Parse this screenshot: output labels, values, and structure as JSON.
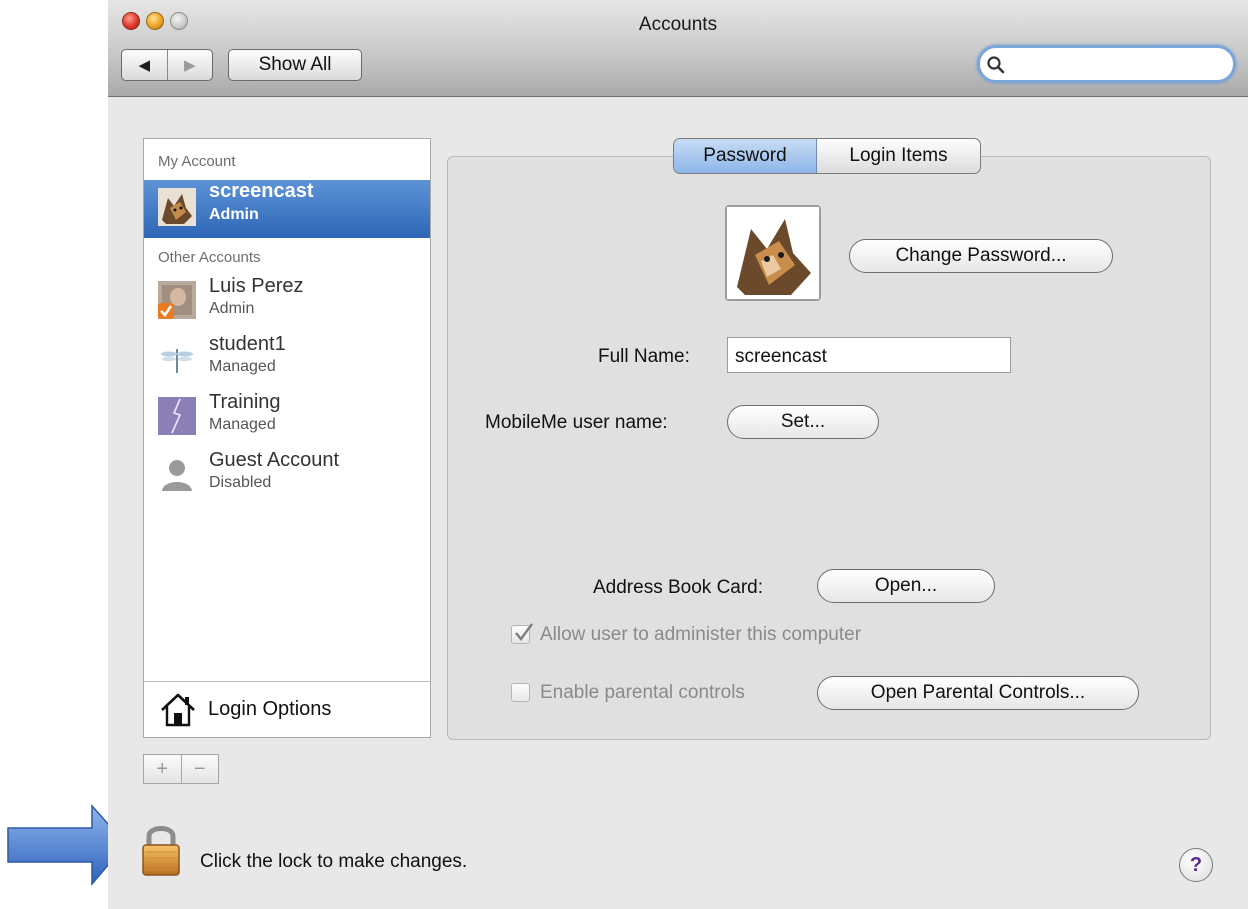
{
  "window": {
    "title": "Accounts"
  },
  "toolbar": {
    "back_glyph": "◀",
    "forward_glyph": "▶",
    "show_all_label": "Show All",
    "search_value": ""
  },
  "sidebar": {
    "my_account_header": "My Account",
    "other_accounts_header": "Other Accounts",
    "accounts": [
      {
        "name": "screencast",
        "role": "Admin",
        "icon": "cat-avatar",
        "selected": true
      },
      {
        "name": "Luis Perez",
        "role": "Admin",
        "icon": "photo-avatar-with-check-badge"
      },
      {
        "name": "student1",
        "role": "Managed",
        "icon": "dragonfly-avatar"
      },
      {
        "name": "Training",
        "role": "Managed",
        "icon": "lightning-avatar"
      },
      {
        "name": "Guest Account",
        "role": "Disabled",
        "icon": "silhouette-avatar"
      }
    ],
    "login_options_label": "Login Options",
    "add_label": "+",
    "remove_label": "−"
  },
  "tabs": [
    {
      "label": "Password",
      "active": true
    },
    {
      "label": "Login Items",
      "active": false
    }
  ],
  "form": {
    "change_password_label": "Change Password...",
    "full_name_label": "Full Name:",
    "full_name_value": "screencast",
    "mobileme_label": "MobileMe user name:",
    "mobileme_button": "Set...",
    "address_book_label": "Address Book Card:",
    "address_book_button": "Open...",
    "allow_admin_label": "Allow user to administer this computer",
    "allow_admin_checked": true,
    "parental_label": "Enable parental controls",
    "parental_checked": false,
    "parental_button": "Open Parental Controls..."
  },
  "footer": {
    "lock_message": "Click the lock to make changes.",
    "help_label": "?"
  },
  "colors": {
    "selection_blue": "#2e66b7",
    "focus_ring": "#7aa6d8",
    "annotation_arrow": "#3d74c8"
  }
}
